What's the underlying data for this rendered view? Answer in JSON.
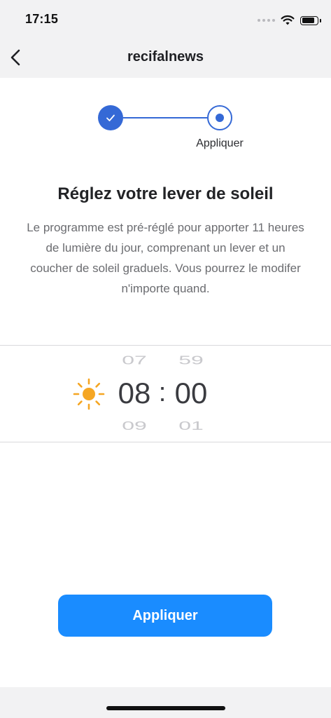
{
  "status_bar": {
    "time": "17:15"
  },
  "nav": {
    "title": "recifalnews",
    "back_icon": "chevron-left-icon"
  },
  "stepper": {
    "steps": [
      {
        "state": "completed",
        "icon": "checkmark-icon"
      },
      {
        "state": "current",
        "label": "Appliquer"
      }
    ],
    "accent_color": "#3569d6"
  },
  "content": {
    "heading": "Réglez votre lever de soleil",
    "description": "Le programme est pré-réglé pour apporter 11 heures de lumière du jour, comprenant un lever et un coucher de soleil graduels. Vous pourrez le modifer n'importe quand."
  },
  "time_picker": {
    "icon": "sun-icon",
    "icon_color": "#f5a623",
    "hours": {
      "previous": "07",
      "selected": "08",
      "next": "09"
    },
    "separator": ":",
    "minutes": {
      "previous": "59",
      "selected": "00",
      "next": "01"
    }
  },
  "actions": {
    "apply_label": "Appliquer",
    "apply_color": "#1a8cff"
  }
}
